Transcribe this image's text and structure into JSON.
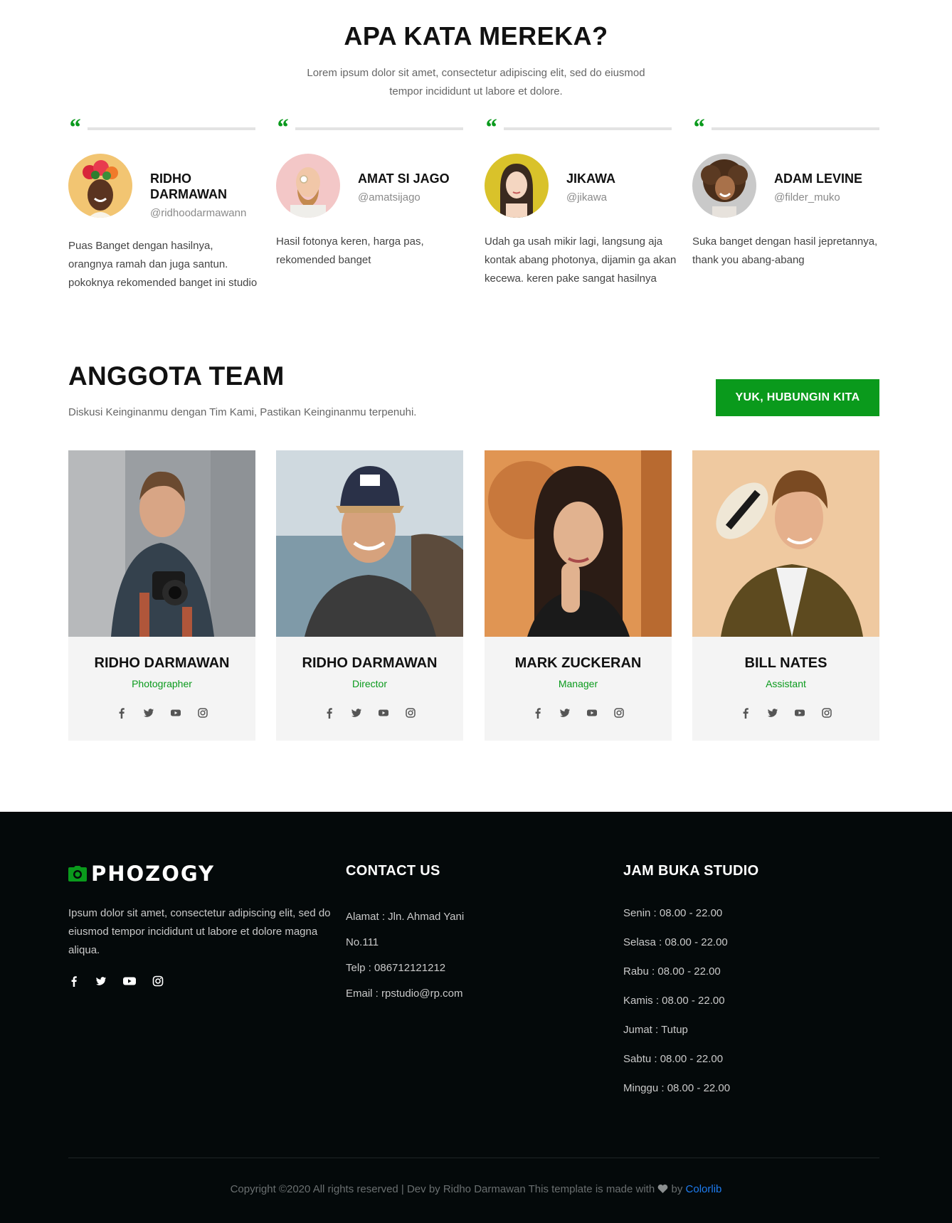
{
  "testimonials": {
    "title": "APA KATA MEREKA?",
    "subtitle": "Lorem ipsum dolor sit amet, consectetur adipiscing elit, sed do eiusmod tempor incididunt ut labore et dolore.",
    "quote_glyph": "“",
    "items": [
      {
        "name": "RIDHO DARMAWAN",
        "handle": "@ridhoodarmawann",
        "text": "Puas Banget dengan hasilnya, orangnya ramah dan juga santun. pokoknya rekomended banget ini studio"
      },
      {
        "name": "AMAT SI JAGO",
        "handle": "@amatsijago",
        "text": "Hasil fotonya keren, harga pas, rekomended banget"
      },
      {
        "name": "JIKAWA",
        "handle": "@jikawa",
        "text": "Udah ga usah mikir lagi, langsung aja kontak abang photonya, dijamin ga akan kecewa. keren pake sangat hasilnya"
      },
      {
        "name": "ADAM LEVINE",
        "handle": "@filder_muko",
        "text": "Suka banget dengan hasil jepretannya, thank you abang-abang"
      }
    ]
  },
  "team": {
    "title": "ANGGOTA TEAM",
    "subtitle": "Diskusi Keinginanmu dengan Tim Kami, Pastikan Keinginanmu terpenuhi.",
    "cta_label": "YUK, HUBUNGIN KITA",
    "members": [
      {
        "name": "RIDHO DARMAWAN",
        "role": "Photographer"
      },
      {
        "name": "RIDHO DARMAWAN",
        "role": "Director"
      },
      {
        "name": "MARK ZUCKERAN",
        "role": "Manager"
      },
      {
        "name": "BILL NATES",
        "role": "Assistant"
      }
    ],
    "social_icons": [
      "facebook-icon",
      "twitter-icon",
      "youtube-icon",
      "instagram-icon"
    ]
  },
  "footer": {
    "logo_text": "PHOZOGY",
    "about": "Ipsum dolor sit amet, consectetur adipiscing elit, sed do eiusmod tempor incididunt ut labore et dolore magna aliqua.",
    "contact": {
      "title": "CONTACT US",
      "lines": [
        "Alamat : Jln. Ahmad Yani",
        "No.111",
        "Telp : 086712121212",
        "Email : rpstudio@rp.com"
      ]
    },
    "hours": {
      "title": "JAM BUKA STUDIO",
      "lines": [
        "Senin : 08.00 - 22.00",
        "Selasa : 08.00 - 22.00",
        "Rabu : 08.00 - 22.00",
        "Kamis : 08.00 - 22.00",
        "Jumat : Tutup",
        "Sabtu : 08.00 - 22.00",
        "Minggu : 08.00 - 22.00"
      ]
    },
    "copyright_prefix": "Copyright ©2020 All rights reserved | Dev by Ridho Darmawan This template is made with",
    "copyright_by": "by",
    "copyright_brand": "Colorlib"
  },
  "colors": {
    "accent": "#0a9a1c",
    "footer_bg": "#04090a",
    "link": "#1e7cf0"
  }
}
